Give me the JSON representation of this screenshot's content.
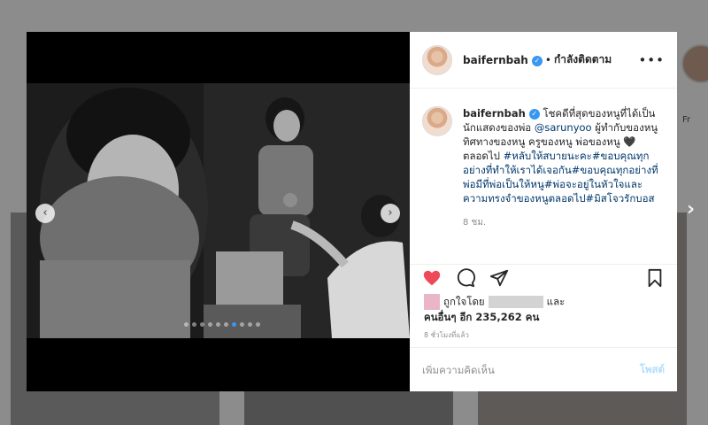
{
  "post": {
    "username": "baifernbah",
    "separator": "•",
    "follow_status": "กำลังติดตาม",
    "caption_user": "baifernbah",
    "caption_line1": "โชคดีที่สุดของหนูที่ได้เป็นนักแสดงของพ่อ",
    "mention": "@sarunyoo",
    "caption_line2": "ผู้ทำกับของหนู ทิศทางของหนู ครูของหนู พ่อของหนู",
    "caption_line3": "ตลอดไป",
    "hashtags": "#หลับให้สบายนะคะ#ขอบคุณทุกอย่างที่ทำให้เราได้เจอกัน#ขอบคุณทุกอย่างที่พ่อมีที่พ่อเป็นให้หนู#พ่อจะอยู่ในหัวใจและความทรงจำของหนูตลอดไป#มิสโจวรักบอส",
    "caption_time": "8 ชม.",
    "liked_by_prefix": "ถูกใจโดย",
    "liked_by_and": "และ",
    "likes_others": "คนอื่นๆ อีก 235,262 คน",
    "time_ago": "8 ชั่วโมงที่แล้ว"
  },
  "comment": {
    "placeholder": "เพิ่มความคิดเห็น",
    "post_label": "โพสต์"
  },
  "background": {
    "side_text": "Fr"
  },
  "icons": [
    "heart-icon",
    "comment-icon",
    "share-icon",
    "bookmark-icon",
    "more-icon",
    "verified-icon",
    "chevron-left-icon",
    "chevron-right-icon",
    "black-heart-icon"
  ],
  "colors": {
    "accent": "#3897f0",
    "like": "#ed4956",
    "post_disabled": "#b2dffc"
  },
  "carousel": {
    "slides": 10,
    "active_index": 6
  }
}
